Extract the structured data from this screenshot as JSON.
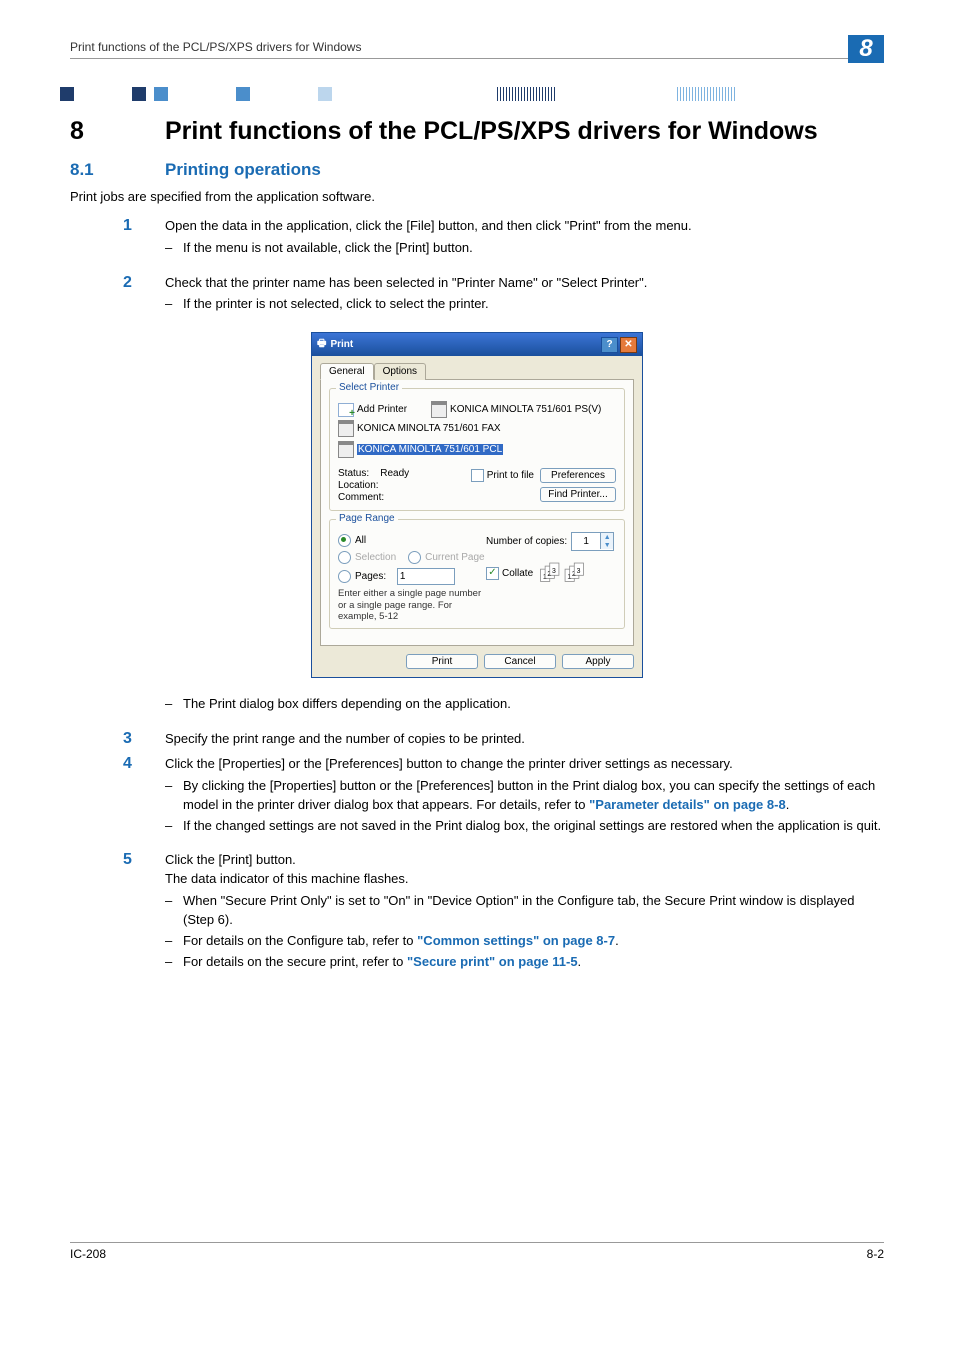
{
  "header": {
    "left": "Print functions of the PCL/PS/XPS drivers for Windows",
    "chapter_number": "8"
  },
  "h1": {
    "num": "8",
    "text": "Print functions of the PCL/PS/XPS drivers for Windows"
  },
  "h2": {
    "num": "8.1",
    "text": "Printing operations"
  },
  "intro": "Print jobs are specified from the application software.",
  "steps": {
    "s1": {
      "num": "1",
      "text": "Open the data in the application, click the [File] button, and then click \"Print\" from the menu.",
      "bullets": [
        "If the menu is not available, click the [Print] button."
      ]
    },
    "s2": {
      "num": "2",
      "text": "Check that the printer name has been selected in \"Printer Name\" or \"Select Printer\".",
      "bullets": [
        "If the printer is not selected, click to select the printer."
      ],
      "after_bullets": [
        "The Print dialog box differs depending on the application."
      ]
    },
    "s3": {
      "num": "3",
      "text": "Specify the print range and the number of copies to be printed."
    },
    "s4": {
      "num": "4",
      "text": "Click the [Properties] or the [Preferences] button to change the printer driver settings as necessary.",
      "bullets": [
        {
          "pre": "By clicking the [Properties] button or the [Preferences] button in the Print dialog box, you can specify the settings of each model in the printer driver dialog box that appears. For details, refer to ",
          "link": "\"Parameter details\" on page 8-8",
          "post": "."
        },
        {
          "pre": "If the changed settings are not saved in the Print dialog box, the original settings are restored when the application is quit."
        }
      ]
    },
    "s5": {
      "num": "5",
      "text": "Click the [Print] button.",
      "text2": "The data indicator of this machine flashes.",
      "bullets": [
        {
          "pre": "When \"Secure Print Only\" is set to \"On\" in \"Device Option\" in the Configure tab, the Secure Print window is displayed (Step 6)."
        },
        {
          "pre": "For details on the Configure tab, refer to ",
          "link": "\"Common settings\" on page 8-7",
          "post": "."
        },
        {
          "pre": "For details on the secure print, refer to ",
          "link": "\"Secure print\" on page 11-5",
          "post": "."
        }
      ]
    }
  },
  "dialog": {
    "title": "Print",
    "tabs": {
      "general": "General",
      "options": "Options"
    },
    "select_printer_title": "Select Printer",
    "printers": {
      "add": "Add Printer",
      "p1": "KONICA MINOLTA 751/601 FAX",
      "p2_selected": "KONICA MINOLTA 751/601 PCL",
      "p3": "KONICA MINOLTA 751/601 PS(V)"
    },
    "status_label": "Status:",
    "status_value": "Ready",
    "location_label": "Location:",
    "comment_label": "Comment:",
    "print_to_file": "Print to file",
    "preferences_btn": "Preferences",
    "find_printer_btn": "Find Printer...",
    "page_range_title": "Page Range",
    "all": "All",
    "selection": "Selection",
    "current_page": "Current Page",
    "pages_label": "Pages:",
    "pages_value": "1",
    "pages_help": "Enter either a single page number or a single page range. For example, 5-12",
    "copies_label": "Number of copies:",
    "copies_value": "1",
    "collate": "Collate",
    "btn_print": "Print",
    "btn_cancel": "Cancel",
    "btn_apply": "Apply"
  },
  "footer": {
    "left": "IC-208",
    "right": "8-2"
  }
}
